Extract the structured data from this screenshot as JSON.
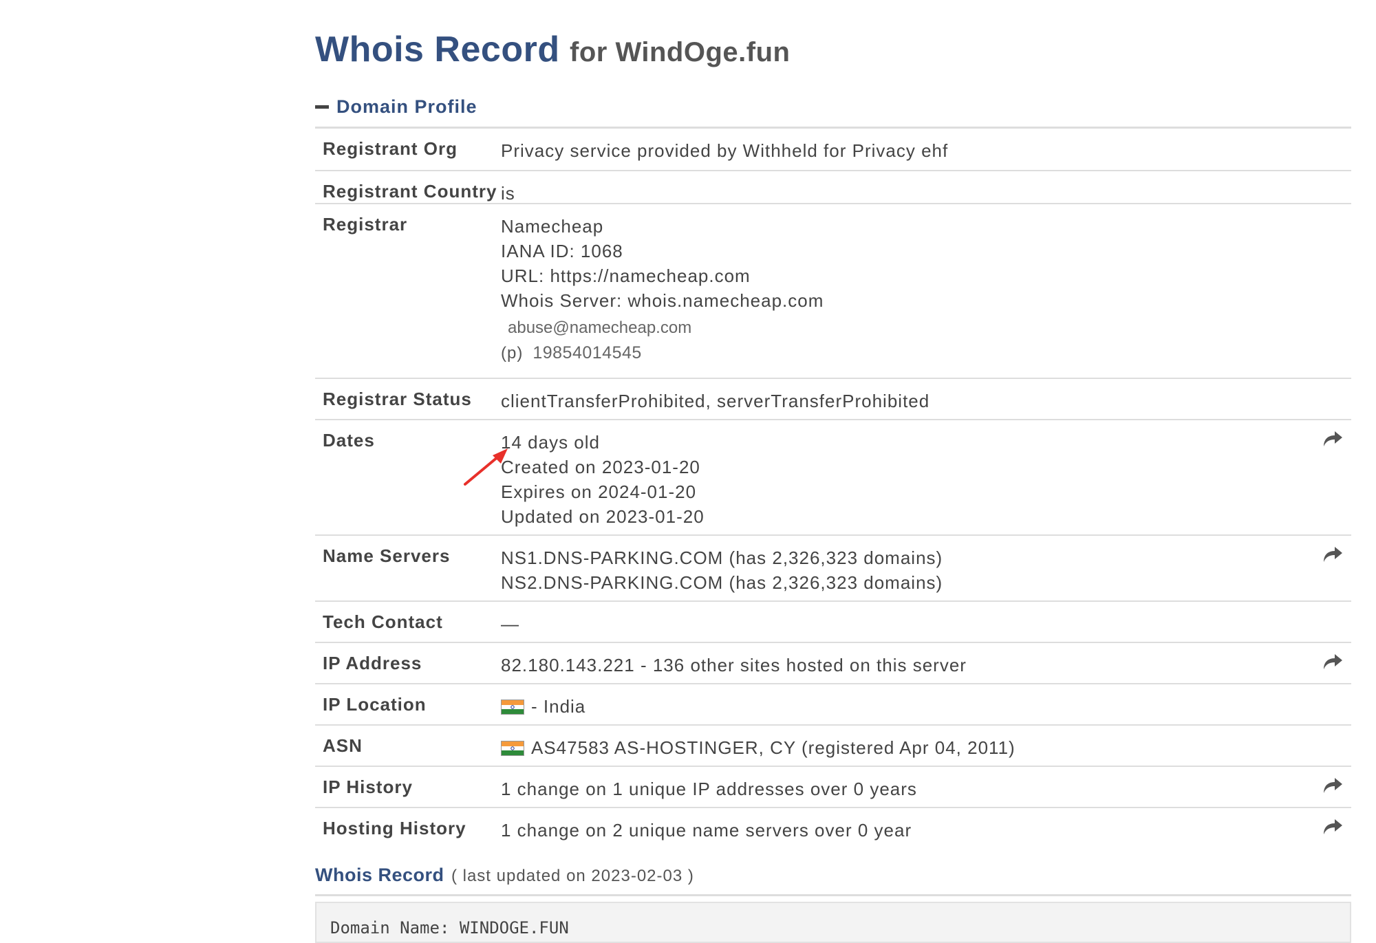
{
  "header": {
    "title": "Whois Record",
    "subtitle": "for WindOge.fun"
  },
  "section": {
    "label": "Domain Profile"
  },
  "rows": {
    "registrant_org": {
      "label": "Registrant Org",
      "value": "Privacy service provided by Withheld for Privacy ehf"
    },
    "registrant_country": {
      "label": "Registrant Country",
      "value": "is"
    },
    "registrar": {
      "label": "Registrar",
      "name": "Namecheap",
      "iana": "IANA ID: 1068",
      "url": "URL: https://namecheap.com",
      "whois_server": "Whois Server: whois.namecheap.com",
      "email": "abuse@namecheap.com",
      "phone_prefix": "(p)",
      "phone": "19854014545"
    },
    "registrar_status": {
      "label": "Registrar Status",
      "value": "clientTransferProhibited, serverTransferProhibited"
    },
    "dates": {
      "label": "Dates",
      "age": "14 days old",
      "created": "Created on 2023-01-20",
      "expires": "Expires on 2024-01-20",
      "updated": "Updated on 2023-01-20"
    },
    "name_servers": {
      "label": "Name Servers",
      "ns1": "NS1.DNS-PARKING.COM (has 2,326,323 domains)",
      "ns2": "NS2.DNS-PARKING.COM (has 2,326,323 domains)"
    },
    "tech_contact": {
      "label": "Tech Contact",
      "value": "—"
    },
    "ip_address": {
      "label": "IP Address",
      "value": "82.180.143.221 - 136 other sites hosted on this server"
    },
    "ip_location": {
      "label": "IP Location",
      "value": "- India"
    },
    "asn": {
      "label": "ASN",
      "value": "AS47583 AS-HOSTINGER, CY (registered Apr 04, 2011)"
    },
    "ip_history": {
      "label": "IP History",
      "value": "1 change on 1 unique IP addresses over 0 years"
    },
    "hosting_history": {
      "label": "Hosting History",
      "value": "1 change on 2 unique name servers over 0 year"
    }
  },
  "whois_record": {
    "title": "Whois Record",
    "updated": "( last updated on 2023-02-03 )",
    "first_line": "Domain Name: WINDOGE.FUN"
  },
  "icons": {
    "share": "share-arrow-icon",
    "collapse": "minus-icon",
    "annotation": "red-arrow",
    "flag": "india-flag-icon"
  },
  "colors": {
    "heading": "#34507f",
    "annotation": "#e8302a",
    "divider": "#dddddd"
  }
}
